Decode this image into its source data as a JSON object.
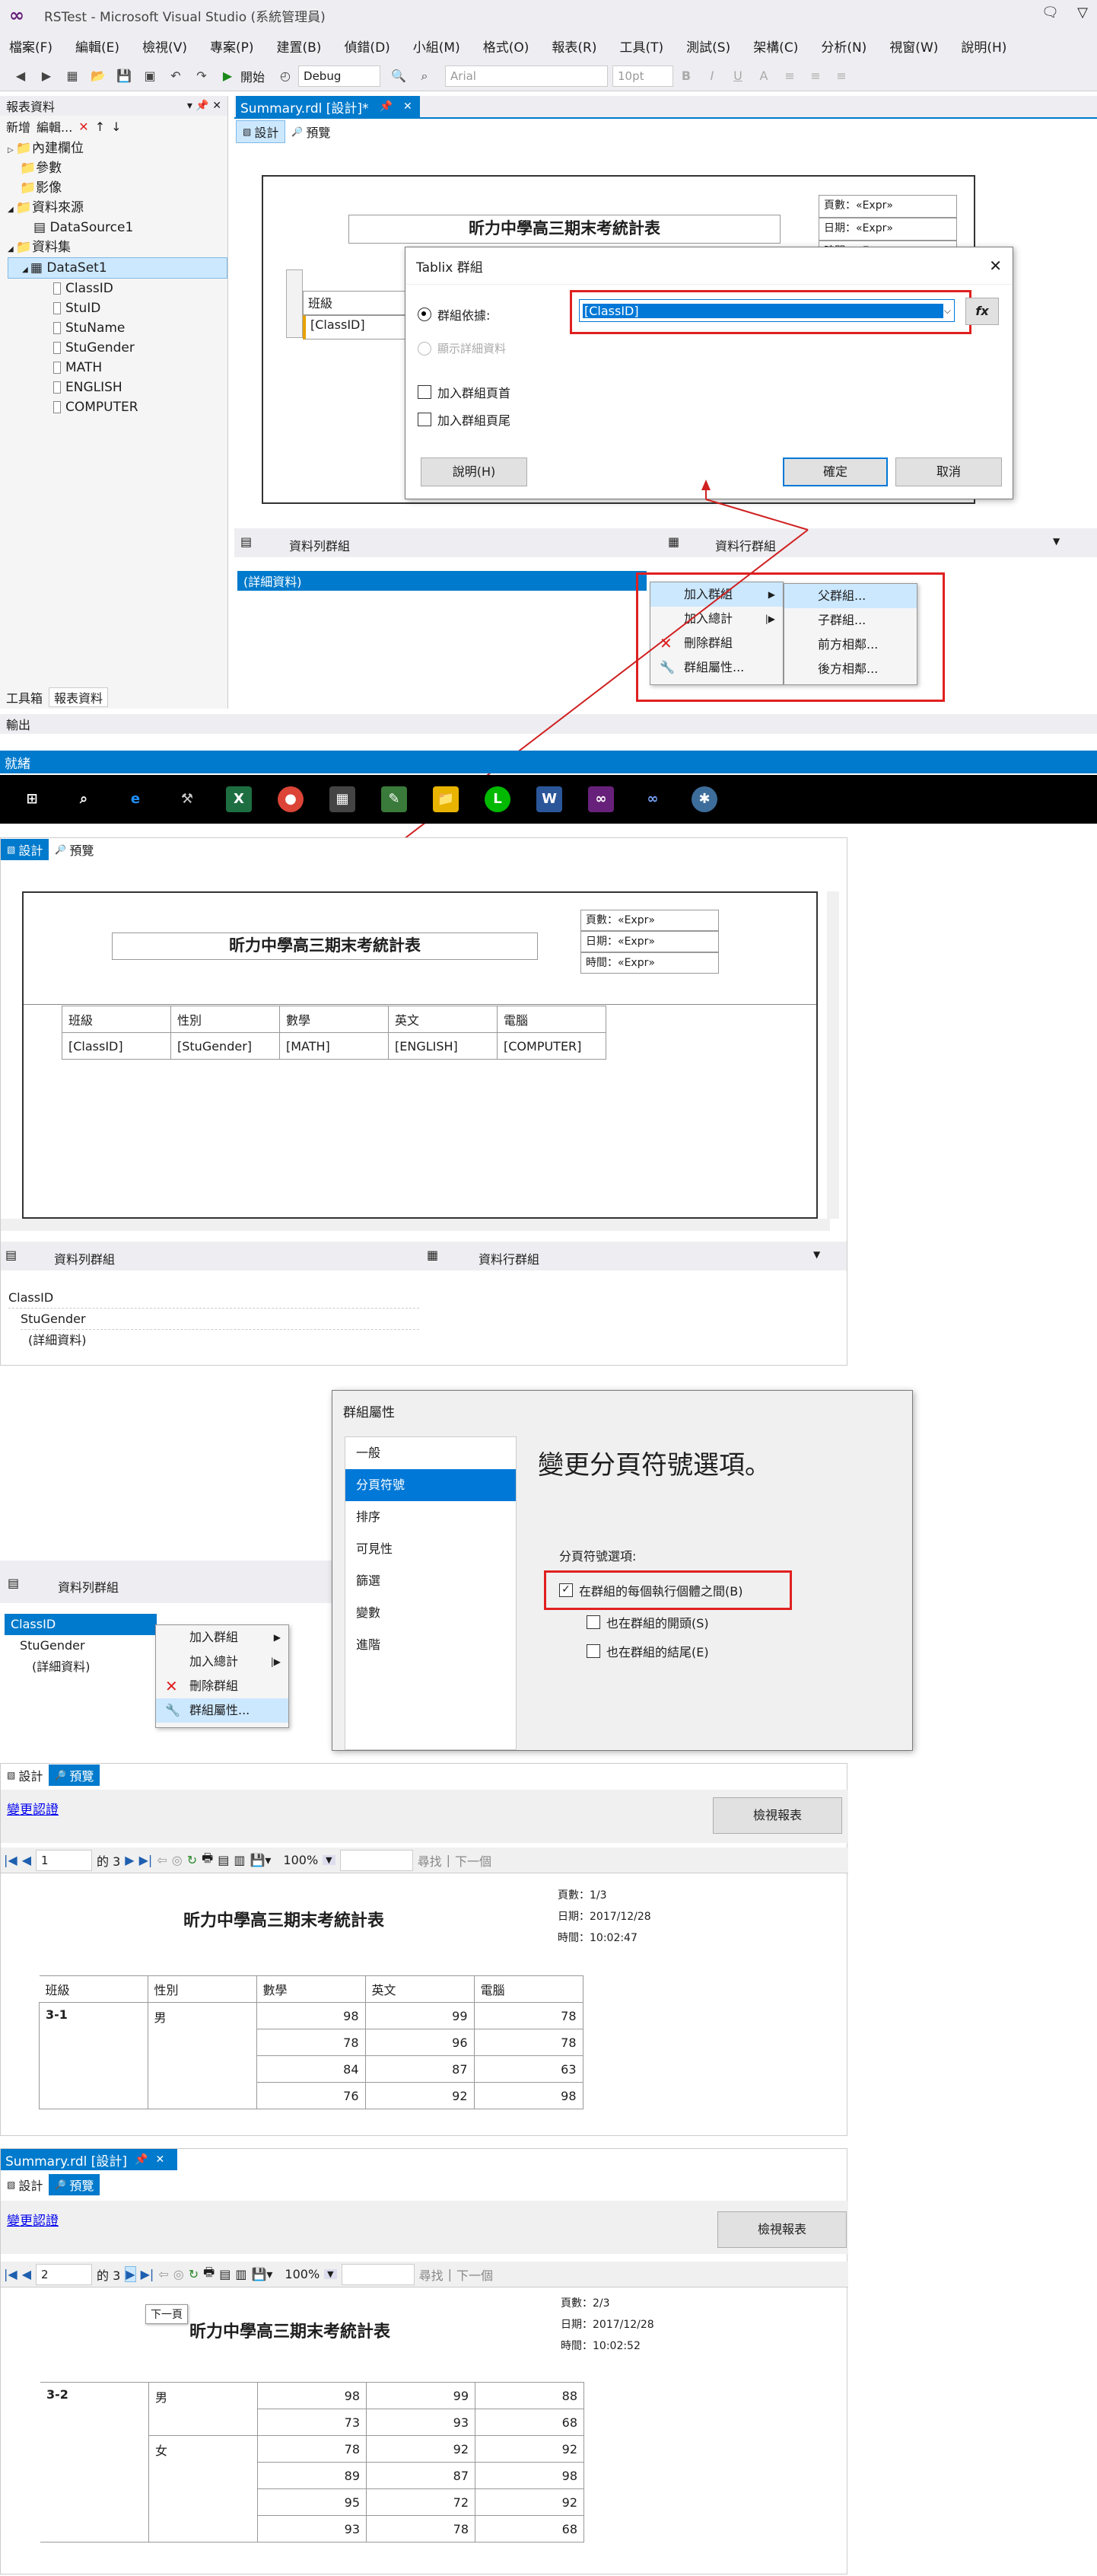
{
  "window": {
    "title": "RSTest - Microsoft Visual Studio (系統管理員)"
  },
  "menu": [
    "檔案(F)",
    "編輯(E)",
    "檢視(V)",
    "專案(P)",
    "建置(B)",
    "偵錯(D)",
    "小組(M)",
    "格式(O)",
    "報表(R)",
    "工具(T)",
    "測試(S)",
    "架構(C)",
    "分析(N)",
    "視窗(W)",
    "說明(H)"
  ],
  "toolbar": {
    "start": "開始",
    "config": "Debug",
    "font": "Arial",
    "size": "10pt"
  },
  "report_data": {
    "title": "報表資料",
    "new": "新增",
    "edit": "編輯...",
    "tree": [
      {
        "label": "內建欄位",
        "level": 0
      },
      {
        "label": "參數",
        "level": 0
      },
      {
        "label": "影像",
        "level": 0
      },
      {
        "label": "資料來源",
        "level": 0
      },
      {
        "label": "DataSource1",
        "level": 1
      },
      {
        "label": "資料集",
        "level": 0
      },
      {
        "label": "DataSet1",
        "level": 1
      },
      {
        "label": "ClassID",
        "level": 2
      },
      {
        "label": "StuID",
        "level": 2
      },
      {
        "label": "StuName",
        "level": 2
      },
      {
        "label": "StuGender",
        "level": 2
      },
      {
        "label": "MATH",
        "level": 2
      },
      {
        "label": "ENGLISH",
        "level": 2
      },
      {
        "label": "COMPUTER",
        "level": 2
      }
    ],
    "tab_toolbox": "工具箱",
    "tab_report_data": "報表資料"
  },
  "output_label": "輸出",
  "status": "就緒",
  "doc": {
    "tab": "Summary.rdl [設計]*",
    "tab_plain": "Summary.rdl [設計]",
    "design": "設計",
    "preview": "預覽",
    "report_title": "昕力中學高三期末考統計表",
    "page_field": "頁數：«Expr»",
    "date_field": "日期：«Expr»",
    "time_field": "時間：«Expr»",
    "header_class": "班級",
    "cell_class": "[ClassID]"
  },
  "tablix_dialog": {
    "title": "Tablix 群組",
    "group_by": "群組依據:",
    "group_value": "[ClassID]",
    "show_detail": "顯示詳細資料",
    "add_header": "加入群組頁首",
    "add_footer": "加入群組頁尾",
    "help": "說明(H)",
    "ok": "確定",
    "cancel": "取消"
  },
  "grouping": {
    "row_groups": "資料列群組",
    "col_groups": "資料行群組",
    "details": "(詳細資料)"
  },
  "context_menu": {
    "add_group": "加入群組",
    "add_total": "加入總計",
    "delete_group": "刪除群組",
    "group_props": "群組屬性...",
    "submenu": [
      "父群組...",
      "子群組...",
      "前方相鄰...",
      "後方相鄰..."
    ]
  },
  "design2": {
    "headers": [
      "班級",
      "性別",
      "數學",
      "英文",
      "電腦"
    ],
    "cells": [
      "[ClassID]",
      "[StuGender]",
      "[MATH]",
      "[ENGLISH]",
      "[COMPUTER]"
    ],
    "groups": [
      "ClassID",
      "StuGender",
      "(詳細資料)"
    ]
  },
  "group_props": {
    "title": "群組屬性",
    "nav": [
      "一般",
      "分頁符號",
      "排序",
      "可見性",
      "篩選",
      "變數",
      "進階"
    ],
    "heading": "變更分頁符號選項。",
    "options_label": "分頁符號選項:",
    "opt1": "在群組的每個執行個體之間(B)",
    "opt2": "也在群組的開頭(S)",
    "opt3": "也在群組的結尾(E)"
  },
  "preview1": {
    "change_cred": "變更認證",
    "view_report": "檢視報表",
    "page": "1",
    "of": "的 3",
    "zoom": "100%",
    "find": "尋找",
    "next": "下一個",
    "page_info": "頁數：1/3",
    "date": "日期：2017/12/28",
    "time": "時間：10:02:47",
    "class": "3-1",
    "gender": "男",
    "rows": [
      [
        "98",
        "99",
        "78"
      ],
      [
        "78",
        "96",
        "78"
      ],
      [
        "84",
        "87",
        "63"
      ],
      [
        "76",
        "92",
        "98"
      ]
    ]
  },
  "preview2": {
    "page": "2",
    "tooltip": "下一頁",
    "page_info": "頁數：2/3",
    "date": "日期：2017/12/28",
    "time": "時間：10:02:52",
    "class": "3-2",
    "male": "男",
    "female": "女",
    "male_rows": [
      [
        "98",
        "99",
        "88"
      ],
      [
        "73",
        "93",
        "68"
      ]
    ],
    "female_rows": [
      [
        "78",
        "92",
        "92"
      ],
      [
        "89",
        "87",
        "98"
      ],
      [
        "95",
        "72",
        "92"
      ],
      [
        "93",
        "78",
        "68"
      ]
    ]
  },
  "colors": {
    "accent": "#007acc",
    "highlight": "#e02020"
  }
}
